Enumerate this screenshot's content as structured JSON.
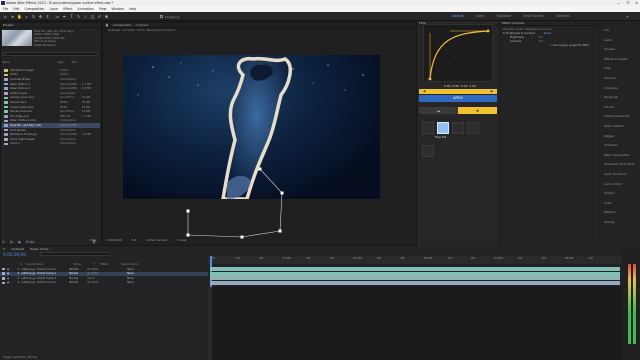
{
  "titlebar": {
    "title": "Adobe After Effects 2023 - D:\\ae projects\\paper outline effect.aep *",
    "win_controls": [
      "—",
      "❐",
      "✕"
    ]
  },
  "menu": [
    "File",
    "Edit",
    "Composition",
    "Layer",
    "Effect",
    "Animation",
    "View",
    "Window",
    "Help"
  ],
  "toolbar": {
    "snapping": "Snapping",
    "workspaces": [
      "Default",
      "Learn",
      "Standard",
      "Small Screen",
      "Libraries"
    ],
    "active_workspace": "Default"
  },
  "project": {
    "title": "Project",
    "meta_lines": [
      "Drop Mo...wrd, us...5d(1,.10)×",
      "1920 x 1080 (1.00)",
      "Δ 0;00;10;00, 29.97 fps",
      "Millions of Colors",
      "Adobe Premiere..."
    ],
    "items": [
      {
        "name": "Uploaded Footage",
        "type": "Folder",
        "size": "",
        "color": "#d6c36b"
      },
      {
        "name": "Solids",
        "type": "Folder",
        "size": "",
        "color": "#d6c36b"
      },
      {
        "name": "Contrast Shape",
        "type": "Composition",
        "size": "",
        "color": "#b2a4c9"
      },
      {
        "name": "Paper Texture 1",
        "type": "ImporterJPEG",
        "size": "2.1 MB",
        "color": "#89a7d1"
      },
      {
        "name": "Paper Texture 2",
        "type": "ImporterJPEG",
        "size": "1.8 MB",
        "color": "#89a7d1"
      },
      {
        "name": "Outline Layer",
        "type": "Composition",
        "size": "",
        "color": "#b2a4c9"
      },
      {
        "name": "Overlay Grain.mov",
        "type": "QuickTime",
        "size": "34 MB",
        "color": "#7fc4b0"
      },
      {
        "name": "Dancer.mp4",
        "type": "MPEG",
        "size": "58 MB",
        "color": "#7fc4b0"
      },
      {
        "name": "Crowd Lights.mp4",
        "type": "MPEG",
        "size": "22 MB",
        "color": "#7fc4b0"
      },
      {
        "name": "Smoke Loop.mov",
        "type": "QuickTime",
        "size": "19 MB",
        "color": "#7fc4b0"
      },
      {
        "name": "Torn Edge.png",
        "type": "PNG file",
        "size": "1.2 MB",
        "color": "#89a7d1"
      },
      {
        "name": "Paper Outline Comp",
        "type": "Composition",
        "size": "",
        "color": "#b2a4c9"
      },
      {
        "name": "Drop Mo...wrd,5d(1,.10)",
        "type": "ImporterJPEG",
        "size": "",
        "color": "#89a7d1",
        "selected": true
      },
      {
        "name": "Final Render",
        "type": "Composition",
        "size": "",
        "color": "#b2a4c9"
      },
      {
        "name": "Reference Frame.jpg",
        "type": "ImporterJPEG",
        "size": "0.9 MB",
        "color": "#89a7d1"
      },
      {
        "name": "Scene Light Sweep",
        "type": "Composition",
        "size": "",
        "color": "#b2a4c9"
      },
      {
        "name": "Comp 1",
        "type": "Composition",
        "size": "",
        "color": "#b2a4c9"
      }
    ],
    "bottom_icons": [
      "interpret-icon",
      "new-folder-icon",
      "new-comp-icon",
      "trash-icon"
    ],
    "bpc": "8 bpc"
  },
  "composition": {
    "tab_label": "Composition",
    "comp_name": "Outlined",
    "breadcrumb": "Outlined  ‹  Drop Mo...5mm...Background Comp 1",
    "zoom": "50%",
    "timecode": "0;00;00;00",
    "resolution": "Full",
    "camera": "Active Camera",
    "view": "1 View"
  },
  "flow": {
    "title": "Flow",
    "curve_values": "0.00, 0.80, 0.32, 1.00",
    "apply_label": "APPLY",
    "presets": [
      "ease-in-out",
      "ease-out",
      "ease-in",
      "linear",
      "bounce"
    ],
    "active_preset_label": "Expo 100"
  },
  "effect_controls": {
    "title": "Effect Controls",
    "target": "Drop Mo...5mm...Background Comp 1",
    "rows": [
      {
        "label": "fx  Brightness & Contrast",
        "value": "Reset"
      },
      {
        "label": "Brightness",
        "value": "0.0"
      },
      {
        "label": "Contrast",
        "value": "0.0"
      },
      {
        "label": "",
        "value": "Use Legacy (supports HDR)"
      }
    ]
  },
  "right_panel": {
    "items": [
      "Info",
      "Audio",
      "Preview",
      "Effects & Presets",
      "Align",
      "Libraries",
      "Character",
      "Paragraph",
      "Tracker",
      "Content-Aware Fill",
      "Motion Sketch",
      "Wiggler",
      "Smoother",
      "Mask Interpolation",
      "Properties: Drop Moti...",
      "Layer Transform",
      "Anchor Point",
      "Position",
      "Scale",
      "Rotation",
      "Opacity"
    ]
  },
  "timeline": {
    "tabs": [
      "Outlined",
      "Paper Comp"
    ],
    "timecode": "0;00;00;00",
    "columns": [
      "#",
      "Source Name",
      "Mode",
      "T",
      "TrkMat",
      "Parent & Link"
    ],
    "layers": [
      {
        "num": "1",
        "name": "outlined_gr...5mm1 Comp 1",
        "mode": "Normal",
        "trk": "No Matte",
        "parent": "None",
        "color": "#b2a4c9",
        "bar": "#7fc1b4"
      },
      {
        "num": "2",
        "name": "outlined_gr...5mm1 Comp 1",
        "mode": "Normal",
        "trk": "No Matte",
        "parent": "None",
        "color": "#b2a4c9",
        "bar": "#7fc1b4",
        "selected": true
      },
      {
        "num": "3",
        "name": "outlined_gr...5mm1 Comp 1",
        "mode": "Normal",
        "trk": "Alpha",
        "parent": "None",
        "color": "#b2a4c9",
        "bar": "#8fb3ad"
      },
      {
        "num": "4",
        "name": "outlined_gr...5mm1 Comp 1",
        "mode": "Normal",
        "trk": "No Matte",
        "parent": "None",
        "color": "#b2a4c9",
        "bar": "#93a9c4"
      }
    ],
    "ruler_ticks": [
      "0f",
      "10f",
      "20f",
      "01:00f",
      "10f",
      "20f",
      "02:00f",
      "10f",
      "20f",
      "03:00f",
      "10f",
      "20f",
      "04:00f",
      "10f",
      "20f",
      "05:00f",
      "10f"
    ],
    "footer": "Toggle Switches / Modes"
  },
  "colors": {
    "accent_blue": "#2e6bbf",
    "accent_yellow": "#f2c12e",
    "timecode_blue": "#4d8ee8"
  }
}
